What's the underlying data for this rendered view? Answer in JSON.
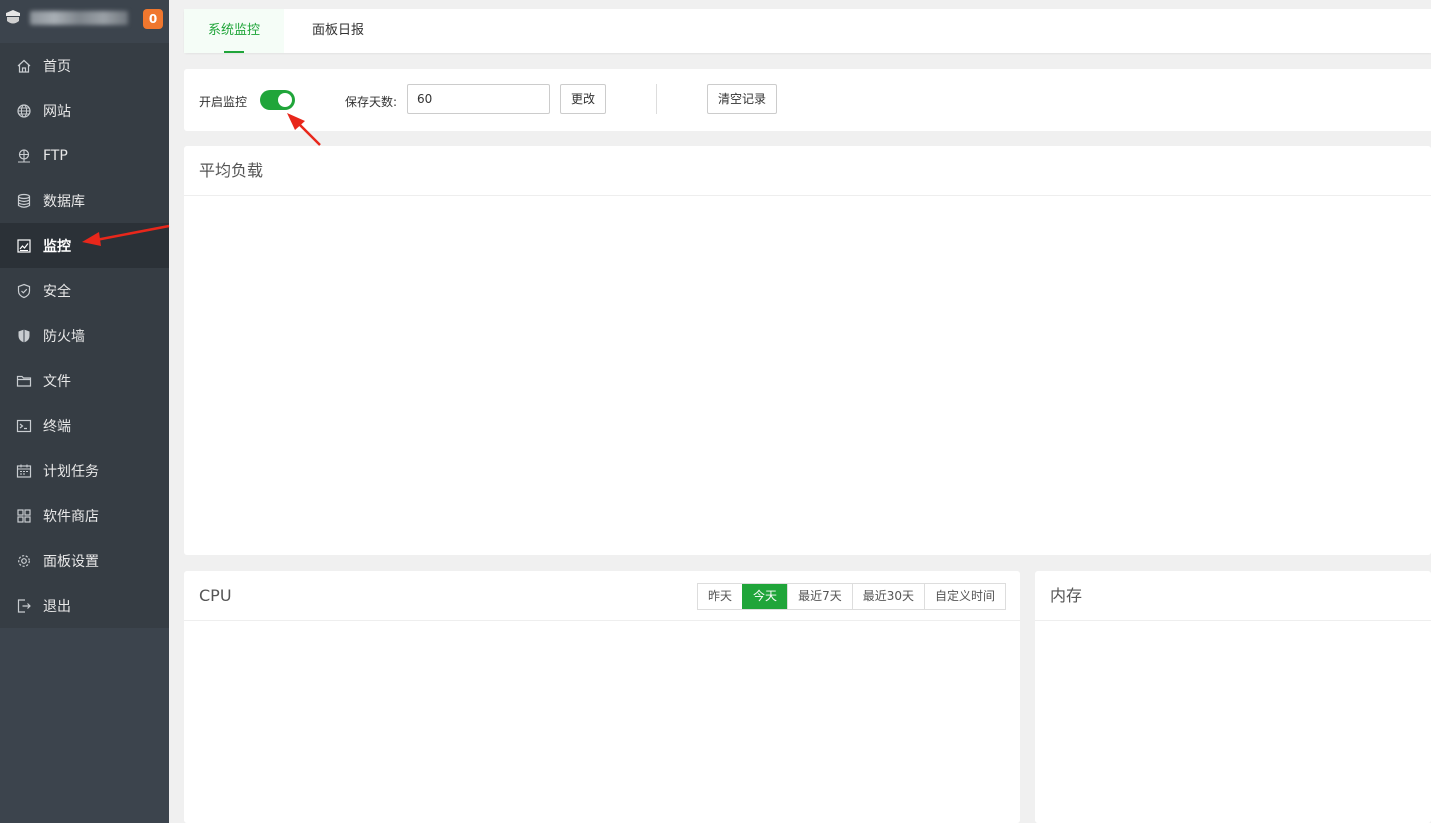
{
  "sidebar": {
    "badge_count": "0",
    "items": [
      {
        "label": "首页",
        "icon": "home-icon"
      },
      {
        "label": "网站",
        "icon": "globe-icon"
      },
      {
        "label": "FTP",
        "icon": "ftp-icon"
      },
      {
        "label": "数据库",
        "icon": "database-icon"
      },
      {
        "label": "监控",
        "icon": "monitor-icon",
        "active": true
      },
      {
        "label": "安全",
        "icon": "shield-check-icon"
      },
      {
        "label": "防火墙",
        "icon": "firewall-shield-icon"
      },
      {
        "label": "文件",
        "icon": "folder-icon"
      },
      {
        "label": "终端",
        "icon": "terminal-icon"
      },
      {
        "label": "计划任务",
        "icon": "calendar-icon"
      },
      {
        "label": "软件商店",
        "icon": "apps-grid-icon"
      },
      {
        "label": "面板设置",
        "icon": "gear-icon"
      },
      {
        "label": "退出",
        "icon": "logout-icon"
      }
    ]
  },
  "tabs": [
    "系统监控",
    "面板日报"
  ],
  "controls": {
    "enable_label": "开启监控",
    "enabled": true,
    "save_days_label": "保存天数:",
    "save_days_value": "60",
    "change_button": "更改",
    "clear_button": "清空记录"
  },
  "panels": {
    "load_title": "平均负载",
    "cpu_title": "CPU",
    "memory_title": "内存",
    "ranges": [
      "昨天",
      "今天",
      "最近7天",
      "最近30天",
      "自定义时间"
    ],
    "selected_range": "今天"
  },
  "colors": {
    "accent": "#20a53a",
    "sidebar_bg": "#3c444d",
    "badge": "#f0772e",
    "annotation_arrow": "#e8271b"
  }
}
